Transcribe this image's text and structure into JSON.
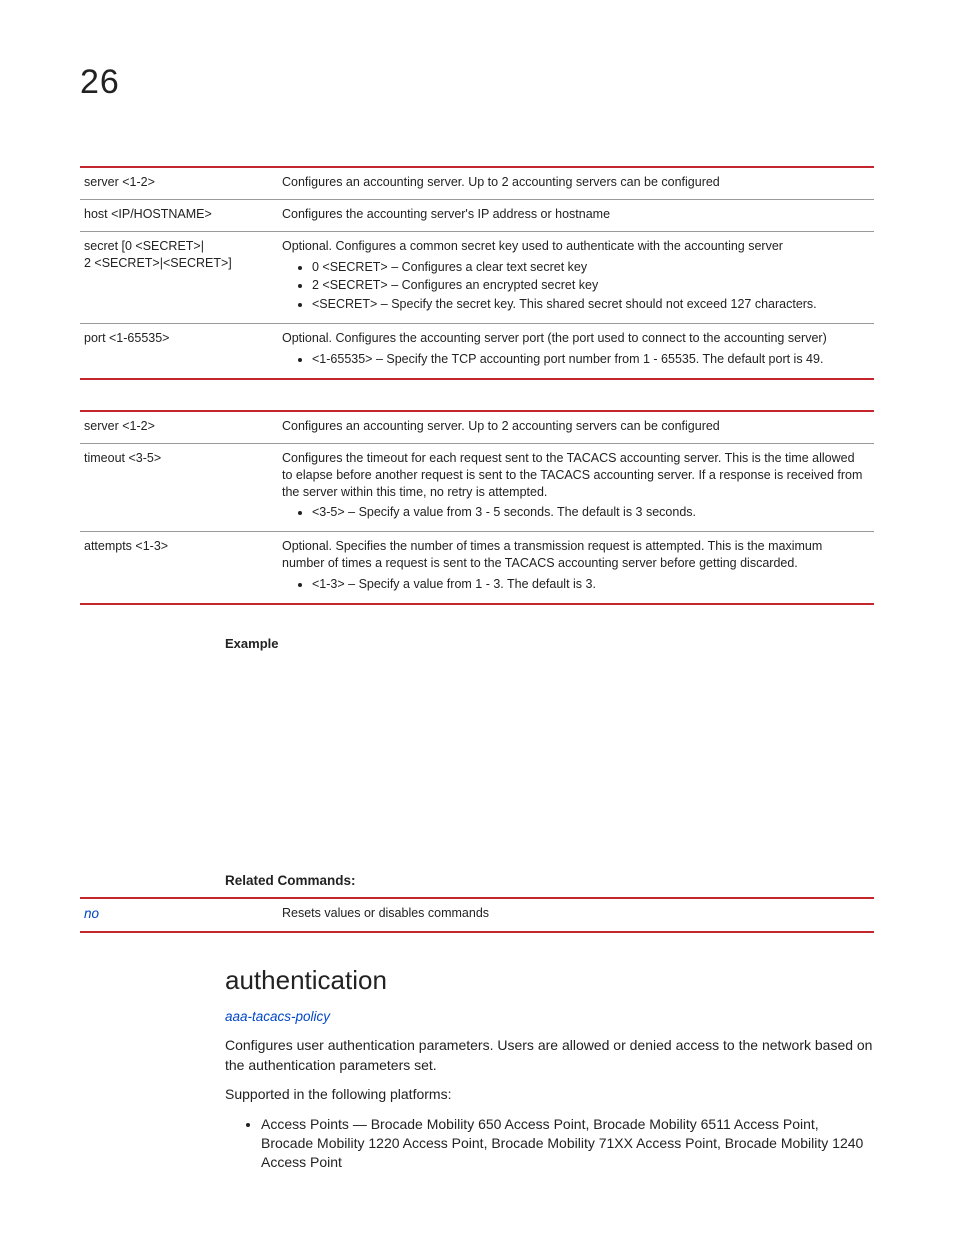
{
  "chapter": "26",
  "table1": {
    "rows": [
      {
        "param": "server <1-2>",
        "desc": "Configures an accounting server. Up to 2 accounting servers can be configured"
      },
      {
        "param": "host <IP/HOSTNAME>",
        "desc": "Configures the accounting server's IP address or hostname"
      },
      {
        "param": "secret [0 <SECRET>|\n2 <SECRET>|<SECRET>]",
        "desc": "Optional. Configures a common secret key used to authenticate with the accounting server",
        "bullets": [
          "0 <SECRET> – Configures a clear text secret key",
          "2 <SECRET> – Configures an encrypted secret key",
          "<SECRET> – Specify the secret key. This shared secret should not exceed 127 characters."
        ]
      },
      {
        "param": "port <1-65535>",
        "desc": "Optional. Configures the accounting server port (the port used to connect to the accounting server)",
        "bullets": [
          "<1-65535> – Specify the TCP accounting port number from 1 - 65535. The default port is 49."
        ]
      }
    ]
  },
  "table2": {
    "rows": [
      {
        "param": "server <1-2>",
        "desc": "Configures an accounting server. Up to 2 accounting servers can be configured"
      },
      {
        "param": "timeout <3-5>",
        "desc": "Configures the timeout for each request sent to the TACACS accounting server. This is the time allowed to elapse before another request is sent to the TACACS accounting server. If a response is received from the server within this time, no retry is attempted.",
        "bullets": [
          "<3-5> – Specify a value from 3 - 5 seconds. The default is 3 seconds."
        ]
      },
      {
        "param": "attempts <1-3>",
        "desc": "Optional. Specifies the number of times a transmission request is attempted. This is the maximum number of times a request is sent to the TACACS accounting server before getting discarded.",
        "bullets": [
          "<1-3> – Specify a value from 1 - 3. The default is 3."
        ]
      }
    ]
  },
  "example_label": "Example",
  "related_label": "Related Commands:",
  "related_table": {
    "rows": [
      {
        "param": "no",
        "desc": "Resets values or disables commands"
      }
    ]
  },
  "section": {
    "title": "authentication",
    "breadcrumb": "aaa-tacacs-policy",
    "para1": "Configures user authentication parameters. Users are allowed or denied access to the network based on the authentication parameters set.",
    "para2": "Supported in the following platforms:",
    "platforms": [
      "Access Points — Brocade Mobility 650 Access Point, Brocade Mobility 6511 Access Point, Brocade Mobility 1220 Access Point, Brocade Mobility 71XX Access Point, Brocade Mobility 1240 Access Point"
    ]
  }
}
